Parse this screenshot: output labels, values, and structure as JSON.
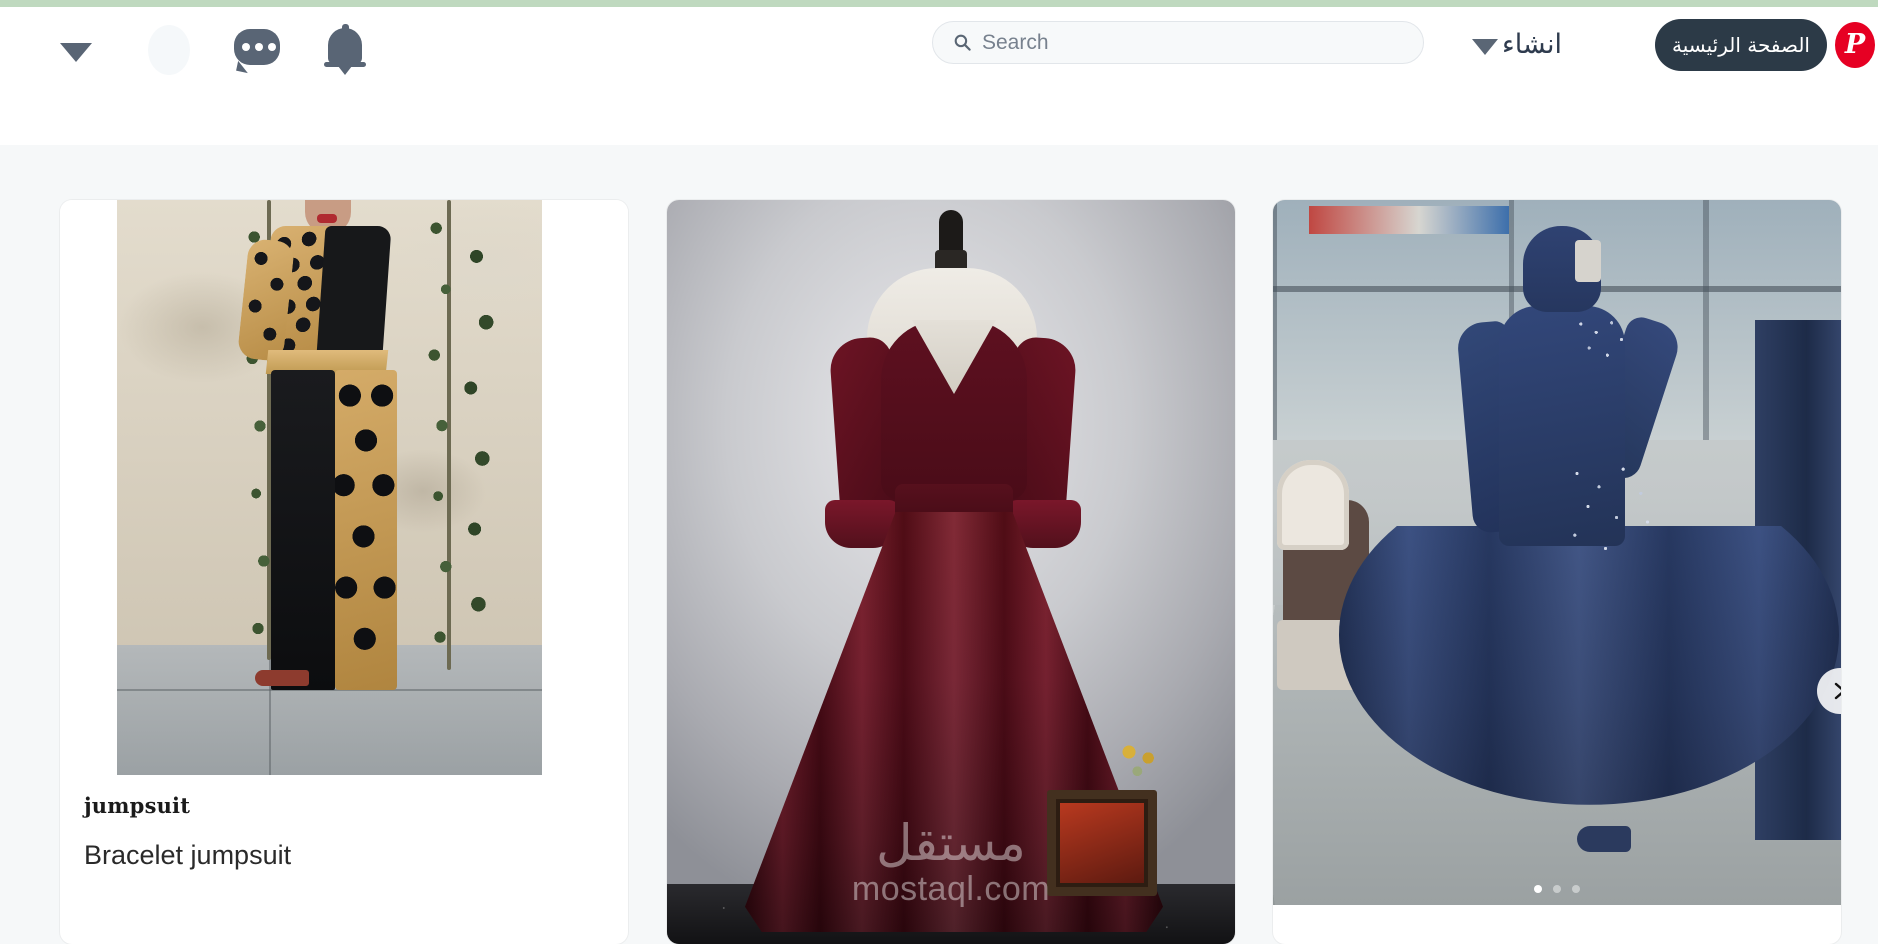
{
  "header": {
    "profile_caret_icon": "chevron-down-icon",
    "avatar_icon": "avatar",
    "messages_icon": "chat-bubble-icon",
    "notifications_icon": "bell-icon",
    "search": {
      "icon": "search-icon",
      "placeholder": "Search",
      "value": ""
    },
    "create_menu": {
      "label": "انشاء",
      "caret_icon": "chevron-down-icon"
    },
    "home_button": {
      "label": "الصفحة الرئيسية"
    },
    "logo": {
      "name": "pinterest-logo",
      "glyph": "P",
      "color": "#e60023"
    }
  },
  "theme": {
    "top_strip_color": "#bfd9bf",
    "header_background": "#ffffff",
    "body_background": "#f6f8f9",
    "button_dark": "#2c3a47",
    "icon_gray": "#596575"
  },
  "grid": {
    "cards": [
      {
        "title": "jumpsuit",
        "subtitle": "Bracelet jumpsuit",
        "image_alt": "polka-dot and gold jumpsuit against a stone wall"
      },
      {
        "title": "",
        "subtitle": "",
        "image_alt": "burgundy velvet gown on a dress form",
        "watermark_ar": "مستقل",
        "watermark_en": "mostaql.com"
      },
      {
        "title": "",
        "subtitle": "",
        "image_alt": "navy blue beaded midi dress in a shop window",
        "next_icon": "chevron-right-icon",
        "carousel_dots": 3,
        "carousel_active": 0
      }
    ]
  }
}
